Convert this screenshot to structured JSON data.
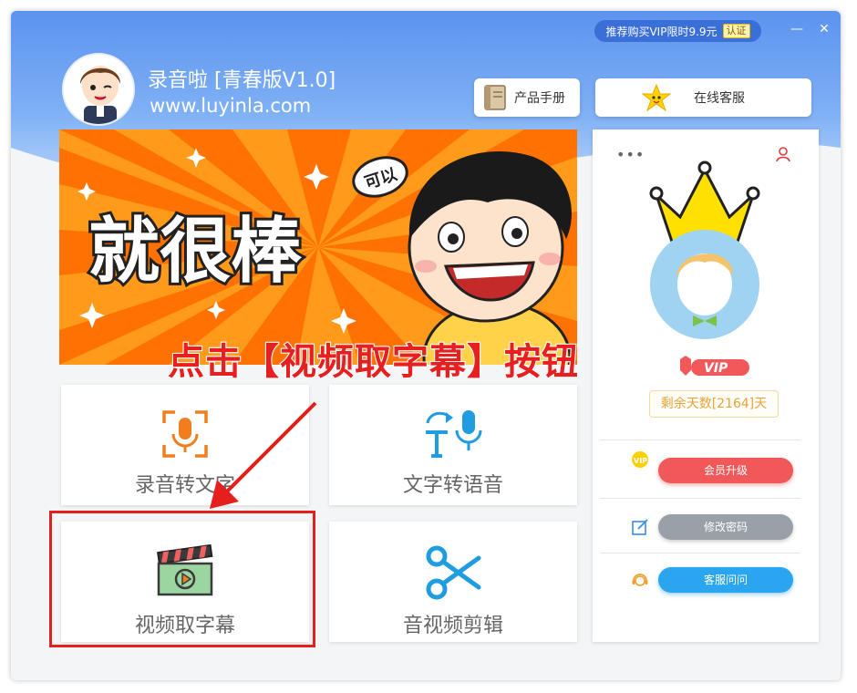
{
  "window": {
    "promo_text": "推荐购买VIP限时9.9元",
    "promo_tag": "认证",
    "minimize": "—",
    "close": "✕"
  },
  "header": {
    "title": "录音啦  [青春版V1.0]",
    "url": "www.luyinla.com",
    "manual_label": "产品手册",
    "service_label": "在线客服"
  },
  "banner": {
    "main_text": "就很棒",
    "bubble_text": "可以"
  },
  "instruction": "点击【视频取字幕】按钮",
  "tiles": [
    {
      "label": "录音转文字",
      "icon": "voice-to-text-icon"
    },
    {
      "label": "文字转语音",
      "icon": "text-to-speech-icon"
    },
    {
      "label": "视频取字幕",
      "icon": "video-clapboard-icon"
    },
    {
      "label": "音视频剪辑",
      "icon": "scissors-icon"
    }
  ],
  "side_panel": {
    "menu_dots": "•••",
    "vip_badge": "VIP",
    "remaining_days": "剩余天数[2164]天",
    "upgrade_label": "会员升级",
    "change_password_label": "修改密码",
    "support_label": "客服问问",
    "vip_icon_text": "VIP"
  },
  "colors": {
    "header_blue": "#5c93ef",
    "accent_orange": "#f07e1e",
    "accent_blue": "#1f9de0",
    "upgrade_red": "#f0585a",
    "password_gray": "#9aa0a8",
    "support_blue": "#2aa6f0",
    "highlight_red": "#e51e1e"
  }
}
